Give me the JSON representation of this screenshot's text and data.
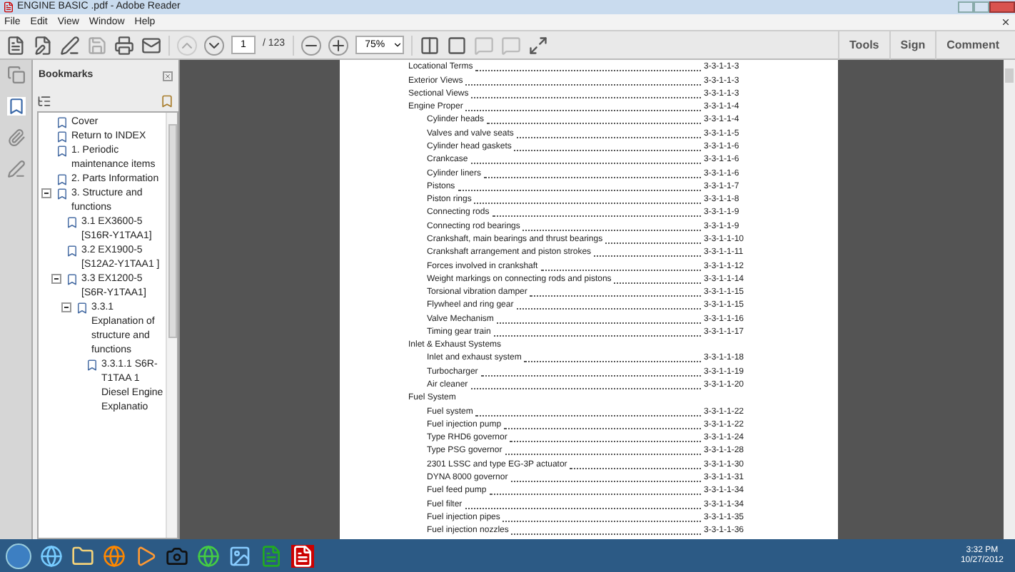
{
  "window": {
    "title": "ENGINE BASIC .pdf - Adobe Reader"
  },
  "menu": [
    "File",
    "Edit",
    "View",
    "Window",
    "Help"
  ],
  "toolbar": {
    "page": "1",
    "page_total": "/ 123",
    "zoom": "75%",
    "actions": [
      "Tools",
      "Sign",
      "Comment"
    ]
  },
  "bookmarks": {
    "title": "Bookmarks",
    "items": [
      {
        "label": "Cover"
      },
      {
        "label": "Return to INDEX"
      },
      {
        "label": "1. Periodic maintenance items"
      },
      {
        "label": "2. Parts Information"
      },
      {
        "label": "3. Structure and functions",
        "expanded": true,
        "children": [
          {
            "label": "3.1 EX3600-5 [S16R-Y1TAA1]"
          },
          {
            "label": "3.2 EX1900-5 [S12A2-Y1TAA1 ]"
          },
          {
            "label": "3.3 EX1200-5 [S6R-Y1TAA1]",
            "expanded": true,
            "children": [
              {
                "label": "3.3.1 Explanation of structure and functions",
                "expanded": true,
                "children": [
                  {
                    "label": "3.3.1.1 S6R-T1TAA 1 Diesel Engine Explanatio"
                  }
                ]
              }
            ]
          }
        ]
      }
    ]
  },
  "toc": [
    {
      "label": "Locational Terms",
      "page": "3-3-1-1-3"
    },
    {
      "label": "Exterior Views",
      "page": "3-3-1-1-3"
    },
    {
      "label": "Sectional Views",
      "page": "3-3-1-1-3"
    },
    {
      "label": "Engine Proper",
      "page": "3-3-1-1-4",
      "children": [
        {
          "label": "Cylinder heads",
          "page": "3-3-1-1-4"
        },
        {
          "label": "Valves and valve seats",
          "page": "3-3-1-1-5"
        },
        {
          "label": "Cylinder head gaskets",
          "page": "3-3-1-1-6"
        },
        {
          "label": "Crankcase",
          "page": "3-3-1-1-6"
        },
        {
          "label": "Cylinder liners",
          "page": "3-3-1-1-6"
        },
        {
          "label": "Pistons",
          "page": "3-3-1-1-7"
        },
        {
          "label": "Piston rings",
          "page": "3-3-1-1-8"
        },
        {
          "label": "Connecting rods",
          "page": "3-3-1-1-9"
        },
        {
          "label": "Connecting rod bearings",
          "page": "3-3-1-1-9"
        },
        {
          "label": "Crankshaft, main bearings and thrust bearings",
          "page": "3-3-1-1-10"
        },
        {
          "label": "Crankshaft arrangement and piston strokes",
          "page": "3-3-1-1-11"
        },
        {
          "label": "Forces involved in crankshaft",
          "page": "3-3-1-1-12"
        },
        {
          "label": "Weight markings on connecting rods and pistons",
          "page": "3-3-1-1-14"
        },
        {
          "label": "Torsional vibration damper",
          "page": "3-3-1-1-15"
        },
        {
          "label": "Flywheel and ring gear",
          "page": "3-3-1-1-15"
        },
        {
          "label": "Valve Mechanism",
          "page": "3-3-1-1-16"
        },
        {
          "label": "Timing gear train",
          "page": "3-3-1-1-17"
        }
      ]
    },
    {
      "label": "Inlet & Exhaust Systems",
      "children": [
        {
          "label": "Inlet and exhaust system",
          "page": "3-3-1-1-18"
        },
        {
          "label": "Turbocharger",
          "page": "3-3-1-1-19"
        },
        {
          "label": "Air cleaner",
          "page": "3-3-1-1-20"
        }
      ]
    },
    {
      "label": "Fuel System",
      "children": [
        {
          "label": "Fuel system",
          "page": "3-3-1-1-22"
        },
        {
          "label": "Fuel injection pump",
          "page": "3-3-1-1-22"
        },
        {
          "label": "Type RHD6 governor",
          "page": "3-3-1-1-24"
        },
        {
          "label": "Type PSG governor",
          "page": "3-3-1-1-28"
        },
        {
          "label": "2301 LSSC and type EG-3P actuator",
          "page": "3-3-1-1-30"
        },
        {
          "label": "DYNA 8000 governor",
          "page": "3-3-1-1-31"
        },
        {
          "label": "Fuel feed pump",
          "page": "3-3-1-1-34"
        },
        {
          "label": "Fuel filter",
          "page": "3-3-1-1-34"
        },
        {
          "label": "Fuel injection pipes",
          "page": "3-3-1-1-35"
        },
        {
          "label": "Fuel injection nozzles",
          "page": "3-3-1-1-36"
        }
      ]
    }
  ],
  "clock": {
    "time": "3:32 PM",
    "date": "10/27/2012"
  }
}
